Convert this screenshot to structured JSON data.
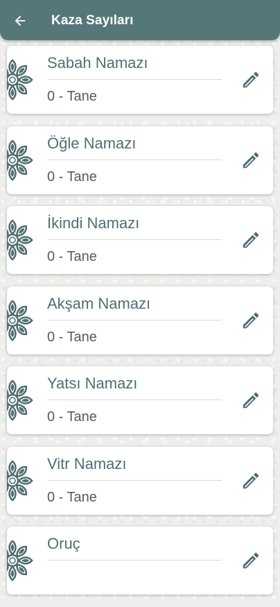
{
  "app_bar": {
    "title": "Kaza Sayıları",
    "back_icon": "arrow-left-icon",
    "color": "#567779"
  },
  "cards": [
    {
      "name": "Sabah Namazı",
      "count_text": "0 - Tane"
    },
    {
      "name": "Öğle Namazı",
      "count_text": "0 - Tane"
    },
    {
      "name": "İkindi Namazı",
      "count_text": "0 - Tane"
    },
    {
      "name": "Akşam Namazı",
      "count_text": "0 - Tane"
    },
    {
      "name": "Yatsı Namazı",
      "count_text": "0 - Tane"
    },
    {
      "name": "Vitr Namazı",
      "count_text": "0 - Tane"
    },
    {
      "name": "Oruç",
      "count_text": ""
    }
  ],
  "icons": {
    "edit": "pencil-icon",
    "decoration": "mandala-icon"
  },
  "colors": {
    "accent": "#4f6e72",
    "card": "#ffffff",
    "background": "#eeeeec"
  }
}
